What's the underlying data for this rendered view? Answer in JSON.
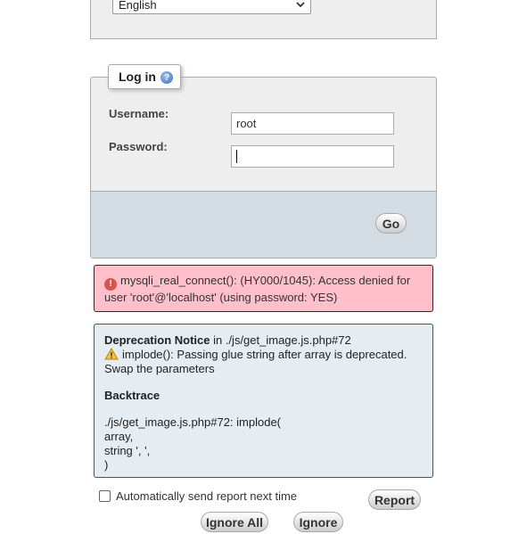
{
  "language": {
    "selected": "English"
  },
  "login": {
    "legend": "Log in",
    "username_label": "Username:",
    "username_value": "root",
    "password_label": "Password:",
    "password_value": "",
    "go_label": "Go"
  },
  "error": {
    "message": "mysqli_real_connect(): (HY000/1045): Access denied for user 'root'@'localhost' (using password: YES)"
  },
  "notice": {
    "title": "Deprecation Notice",
    "in_text": " in ./js/get_image.js.php#72",
    "message": "implode(): Passing glue string after array is deprecated. Swap the parameters",
    "backtrace_title": "Backtrace",
    "backtrace_line1": "./js/get_image.js.php#72: implode(",
    "backtrace_line2": "array,",
    "backtrace_line3": "string ', ',",
    "backtrace_line4": ")"
  },
  "report": {
    "auto_send_label": "Automatically send report next time",
    "auto_send_checked": false,
    "report_label": "Report",
    "ignore_all_label": "Ignore All",
    "ignore_label": "Ignore"
  },
  "colors": {
    "error_bg": "#ffc0cb",
    "notice_bg": "#e5edf3",
    "footer_bg": "#d3dce3"
  }
}
